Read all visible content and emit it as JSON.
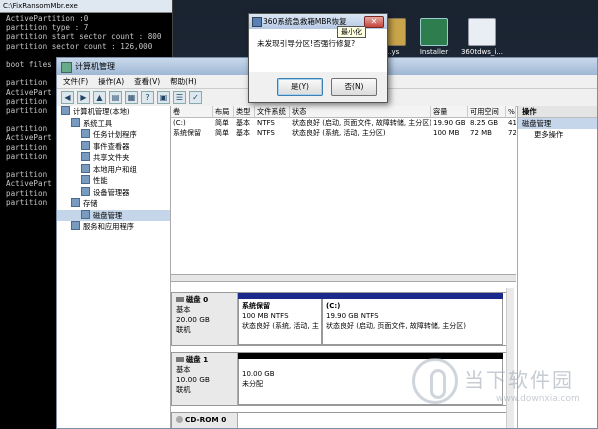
{
  "desktop": {
    "icons": [
      {
        "label": "Installer",
        "icon": "installer-icon"
      },
      {
        "label": "360tdws_i...",
        "icon": "file-icon"
      },
      {
        "label": "...ys",
        "icon": "folder-icon"
      }
    ]
  },
  "console": {
    "title": "C:\\FixRansomMbr.exe",
    "lines": [
      "ActivePartition :0",
      "partition type : 7",
      "partition start sector count : 800",
      "partition sector count : 126,000",
      "",
      "boot files",
      "",
      "partition",
      "ActivePart",
      "partition",
      "partition",
      "",
      "partition",
      "ActivePart",
      "partition",
      "partition",
      "",
      "partition",
      "ActivePart",
      "partition",
      "partition"
    ]
  },
  "mgmt": {
    "title": "计算机管理",
    "menu": [
      "文件(F)",
      "操作(A)",
      "查看(V)",
      "帮助(H)"
    ],
    "tree": [
      {
        "label": "计算机管理(本地)",
        "indent": 0,
        "icon": "computer-icon"
      },
      {
        "label": "系统工具",
        "indent": 1,
        "icon": "tools-icon"
      },
      {
        "label": "任务计划程序",
        "indent": 2,
        "icon": "clock-icon"
      },
      {
        "label": "事件查看器",
        "indent": 2,
        "icon": "event-icon"
      },
      {
        "label": "共享文件夹",
        "indent": 2,
        "icon": "folder-icon"
      },
      {
        "label": "本地用户和组",
        "indent": 2,
        "icon": "users-icon"
      },
      {
        "label": "性能",
        "indent": 2,
        "icon": "performance-icon"
      },
      {
        "label": "设备管理器",
        "indent": 2,
        "icon": "device-icon"
      },
      {
        "label": "存储",
        "indent": 1,
        "icon": "storage-icon"
      },
      {
        "label": "磁盘管理",
        "indent": 2,
        "icon": "disk-icon"
      },
      {
        "label": "服务和应用程序",
        "indent": 1,
        "icon": "services-icon"
      }
    ],
    "columns": [
      "卷",
      "布局",
      "类型",
      "文件系统",
      "状态",
      "容量",
      "可用空间",
      "%"
    ],
    "volumes": [
      {
        "vol": "(C:)",
        "layout": "简单",
        "type": "基本",
        "fs": "NTFS",
        "status": "状态良好 (启动, 页面文件, 故障转储, 主分区)",
        "cap": "19.90 GB",
        "free": "8.25 GB",
        "pct": "41"
      },
      {
        "vol": "系统保留",
        "layout": "简单",
        "type": "基本",
        "fs": "NTFS",
        "status": "状态良好 (系统, 活动, 主分区)",
        "cap": "100 MB",
        "free": "72 MB",
        "pct": "72"
      }
    ],
    "disks": [
      {
        "name": "磁盘 0",
        "kind": "基本",
        "size": "20.00 GB",
        "state": "联机",
        "parts": [
          {
            "name": "系统保留",
            "size": "100 MB NTFS",
            "status": "状态良好 (系统, 活动, 主"
          },
          {
            "name": "(C:)",
            "size": "19.90 GB NTFS",
            "status": "状态良好 (启动, 页面文件, 故障转储, 主分区)"
          }
        ]
      },
      {
        "name": "磁盘 1",
        "kind": "基本",
        "size": "10.00 GB",
        "state": "联机",
        "parts": [
          {
            "name": "",
            "size": "10.00 GB",
            "status": "未分配"
          }
        ]
      },
      {
        "name": "CD-ROM 0"
      }
    ],
    "actions": {
      "header": "操作",
      "selected": "磁盘管理",
      "more": "更多操作"
    }
  },
  "dialog": {
    "title": "360系统急救箱MBR恢复",
    "message": "未发现引导分区!否强行修复?",
    "yes": "是(Y)",
    "no": "否(N)",
    "tooltip": "最小化"
  },
  "watermark": {
    "text": "当下软件园",
    "url": "www.downxia.com"
  }
}
